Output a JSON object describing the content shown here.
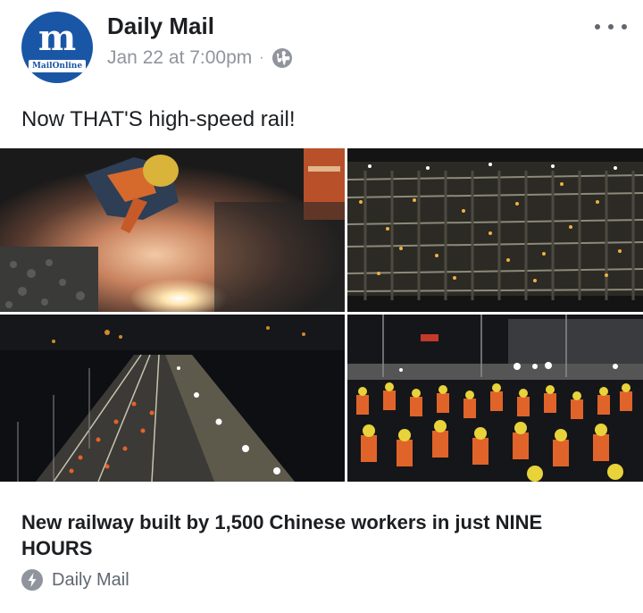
{
  "post": {
    "page_name": "Daily Mail",
    "timestamp": "Jan 22 at 7:00pm",
    "separator": "·",
    "privacy_icon": "globe-icon",
    "more_icon": "more-dots-icon",
    "caption": "Now THAT'S high-speed rail!"
  },
  "avatar": {
    "logo_letter": "m",
    "logo_wordmark": "MailOnline",
    "brand_color": "#1a56a6"
  },
  "photos": [
    {
      "name": "worker-welding-sparks"
    },
    {
      "name": "aerial-tracks-night"
    },
    {
      "name": "railway-corridor-lights"
    },
    {
      "name": "crowd-of-workers-hardhats"
    }
  ],
  "link": {
    "headline": "New railway built by 1,500 Chinese workers in just NINE HOURS",
    "source_icon": "bolt-icon",
    "source": "Daily Mail"
  },
  "colors": {
    "text_primary": "#1c1e21",
    "text_secondary": "#90949c",
    "icon_gray": "#606770"
  }
}
